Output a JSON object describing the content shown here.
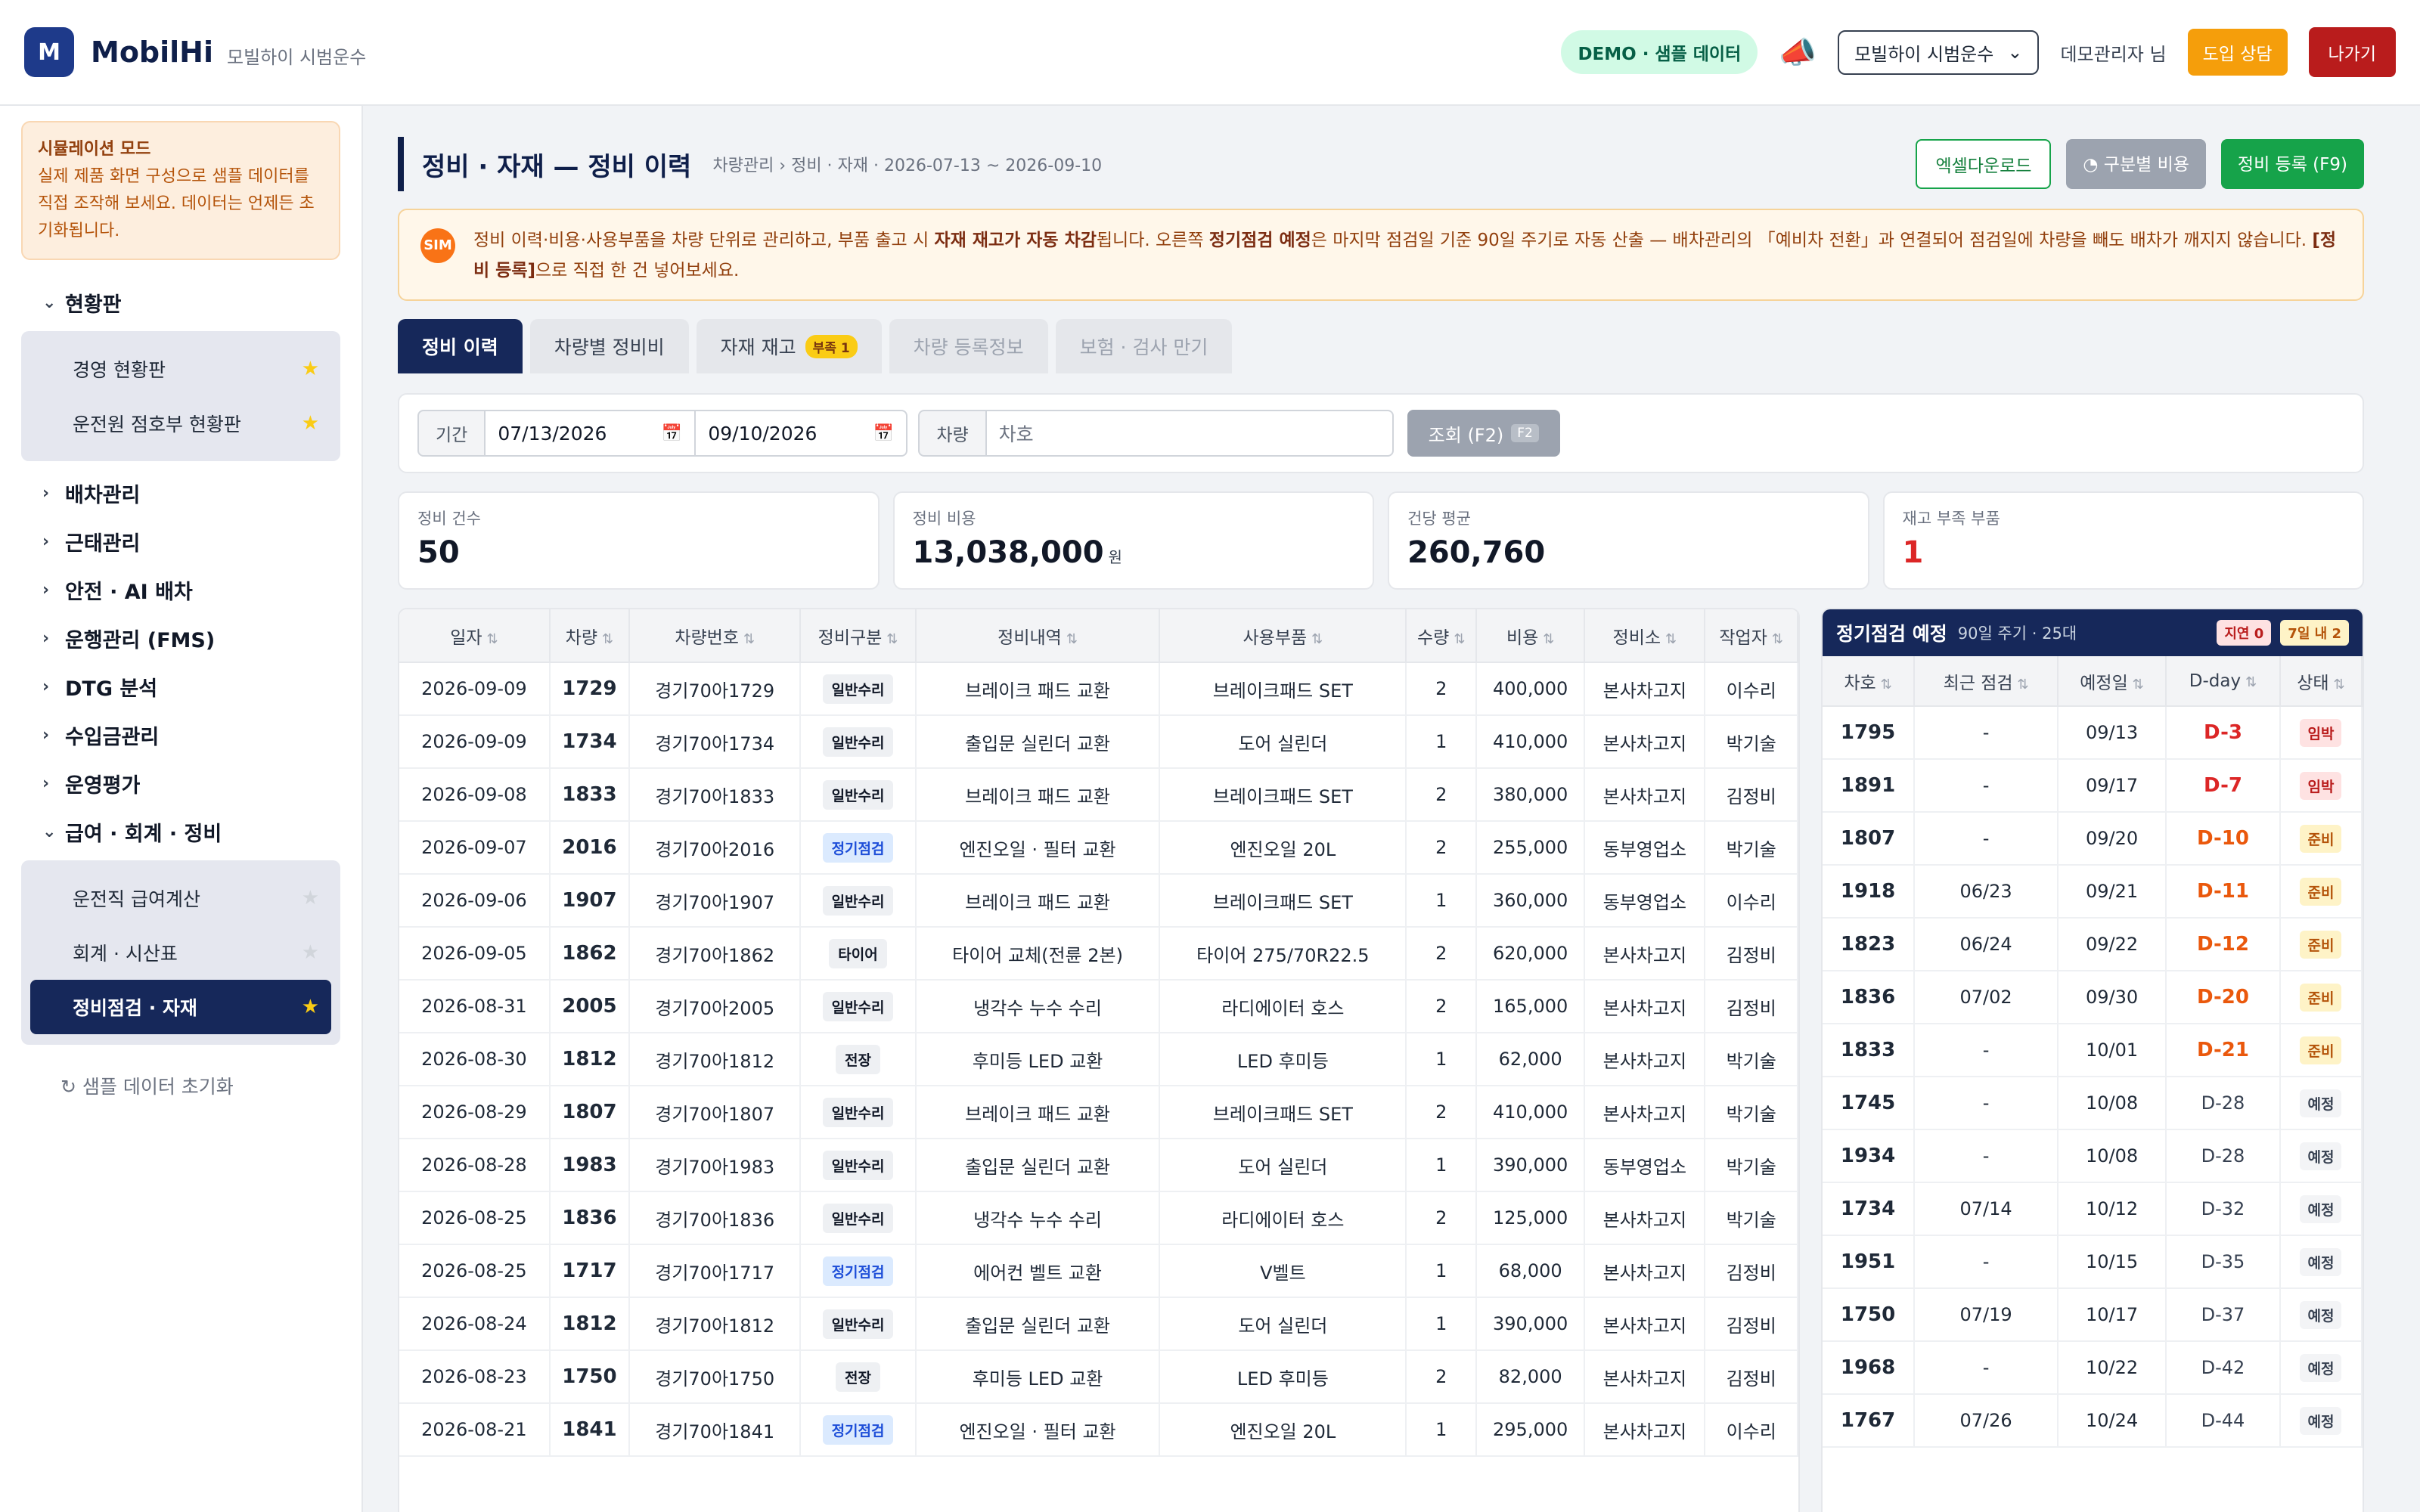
{
  "header": {
    "logo_letter": "M",
    "brand": "MobilHi",
    "brand_sub": "모빌하이 시범운수",
    "demo_pill": "DEMO · 샘플 데이터",
    "company_select": "모빌하이 시범운수",
    "user": "데모관리자 님",
    "consult_btn": "도입 상담",
    "exit_btn": "나가기"
  },
  "sidebar": {
    "sim_title": "시뮬레이션 모드",
    "sim_text": "실제 제품 화면 구성으로 샘플 데이터를 직접 조작해 보세요. 데이터는 언제든 초기화됩니다.",
    "groups": [
      {
        "label": "현황판",
        "open": true,
        "items": [
          {
            "label": "경영 현황판",
            "starred": true
          },
          {
            "label": "운전원 점호부 현황판",
            "starred": true
          }
        ]
      },
      {
        "label": "배차관리",
        "open": false
      },
      {
        "label": "근태관리",
        "open": false
      },
      {
        "label": "안전 · AI 배차",
        "open": false
      },
      {
        "label": "운행관리 (FMS)",
        "open": false
      },
      {
        "label": "DTG 분석",
        "open": false
      },
      {
        "label": "수입금관리",
        "open": false
      },
      {
        "label": "운영평가",
        "open": false
      },
      {
        "label": "급여 · 회계 · 정비",
        "open": true,
        "items": [
          {
            "label": "운전직 급여계산",
            "starred": false
          },
          {
            "label": "회계 · 시산표",
            "starred": false
          },
          {
            "label": "정비점검 · 자재",
            "starred": true,
            "active": true
          }
        ]
      }
    ],
    "reset": "샘플 데이터 초기화"
  },
  "page": {
    "title": "정비 · 자재 — 정비 이력",
    "breadcrumb": "차량관리 › 정비 · 자재 · 2026-07-13 ~ 2026-09-10",
    "excel_btn": "엑셀다운로드",
    "cost_btn": "구분별 비용",
    "register_btn": "정비 등록 (F9)"
  },
  "notice": {
    "icon": "SIM",
    "p1": "정비 이력·비용·사용부품을 차량 단위로 관리하고, 부품 출고 시 ",
    "b1": "자재 재고가 자동 차감",
    "p2": "됩니다. 오른쪽 ",
    "b2": "정기점검 예정",
    "p3": "은 마지막 점검일 기준 90일 주기로 자동 산출 — 배차관리의 「예비차 전환」과 연결되어 점검일에 차량을 빼도 배차가 깨지지 않습니다. ",
    "b3": "[정비 등록]",
    "p4": "으로 직접 한 건 넣어보세요."
  },
  "tabs": [
    {
      "label": "정비 이력",
      "state": "active"
    },
    {
      "label": "차량별 정비비",
      "state": "normal"
    },
    {
      "label": "자재 재고",
      "state": "normal",
      "badge": "부족 1"
    },
    {
      "label": "차량 등록정보",
      "state": "disabled"
    },
    {
      "label": "보험 · 검사 만기",
      "state": "disabled"
    }
  ],
  "filter": {
    "period_label": "기간",
    "date_from": "07/13/2026",
    "date_to": "09/10/2026",
    "vehicle_label": "차량",
    "vehicle_placeholder": "차호",
    "search_btn": "조회 (F2)",
    "search_kbd": "F2"
  },
  "stats": [
    {
      "label": "정비 건수",
      "value": "50",
      "unit": ""
    },
    {
      "label": "정비 비용",
      "value": "13,038,000",
      "unit": "원"
    },
    {
      "label": "건당 평균",
      "value": "260,760",
      "unit": ""
    },
    {
      "label": "재고 부족 부품",
      "value": "1",
      "unit": "",
      "red": true
    }
  ],
  "table": {
    "columns": [
      "일자",
      "차량",
      "차량번호",
      "정비구분",
      "정비내역",
      "사용부품",
      "수량",
      "비용",
      "정비소",
      "작업자"
    ],
    "rows": [
      [
        "2026-09-09",
        "1729",
        "경기70아1729",
        "일반수리",
        "브레이크 패드 교환",
        "브레이크패드 SET",
        "2",
        "400,000",
        "본사차고지",
        "이수리"
      ],
      [
        "2026-09-09",
        "1734",
        "경기70아1734",
        "일반수리",
        "출입문 실린더 교환",
        "도어 실린더",
        "1",
        "410,000",
        "본사차고지",
        "박기술"
      ],
      [
        "2026-09-08",
        "1833",
        "경기70아1833",
        "일반수리",
        "브레이크 패드 교환",
        "브레이크패드 SET",
        "2",
        "380,000",
        "본사차고지",
        "김정비"
      ],
      [
        "2026-09-07",
        "2016",
        "경기70아2016",
        "정기점검",
        "엔진오일 · 필터 교환",
        "엔진오일 20L",
        "2",
        "255,000",
        "동부영업소",
        "박기술"
      ],
      [
        "2026-09-06",
        "1907",
        "경기70아1907",
        "일반수리",
        "브레이크 패드 교환",
        "브레이크패드 SET",
        "1",
        "360,000",
        "동부영업소",
        "이수리"
      ],
      [
        "2026-09-05",
        "1862",
        "경기70아1862",
        "타이어",
        "타이어 교체(전륜 2본)",
        "타이어 275/70R22.5",
        "2",
        "620,000",
        "본사차고지",
        "김정비"
      ],
      [
        "2026-08-31",
        "2005",
        "경기70아2005",
        "일반수리",
        "냉각수 누수 수리",
        "라디에이터 호스",
        "2",
        "165,000",
        "본사차고지",
        "김정비"
      ],
      [
        "2026-08-30",
        "1812",
        "경기70아1812",
        "전장",
        "후미등 LED 교환",
        "LED 후미등",
        "1",
        "62,000",
        "본사차고지",
        "박기술"
      ],
      [
        "2026-08-29",
        "1807",
        "경기70아1807",
        "일반수리",
        "브레이크 패드 교환",
        "브레이크패드 SET",
        "2",
        "410,000",
        "본사차고지",
        "박기술"
      ],
      [
        "2026-08-28",
        "1983",
        "경기70아1983",
        "일반수리",
        "출입문 실린더 교환",
        "도어 실린더",
        "1",
        "390,000",
        "동부영업소",
        "박기술"
      ],
      [
        "2026-08-25",
        "1836",
        "경기70아1836",
        "일반수리",
        "냉각수 누수 수리",
        "라디에이터 호스",
        "2",
        "125,000",
        "본사차고지",
        "박기술"
      ],
      [
        "2026-08-25",
        "1717",
        "경기70아1717",
        "정기점검",
        "에어컨 벨트 교환",
        "V벨트",
        "1",
        "68,000",
        "본사차고지",
        "김정비"
      ],
      [
        "2026-08-24",
        "1812",
        "경기70아1812",
        "일반수리",
        "출입문 실린더 교환",
        "도어 실린더",
        "1",
        "390,000",
        "본사차고지",
        "김정비"
      ],
      [
        "2026-08-23",
        "1750",
        "경기70아1750",
        "전장",
        "후미등 LED 교환",
        "LED 후미등",
        "2",
        "82,000",
        "본사차고지",
        "김정비"
      ],
      [
        "2026-08-21",
        "1841",
        "경기70아1841",
        "정기점검",
        "엔진오일 · 필터 교환",
        "엔진오일 20L",
        "1",
        "295,000",
        "본사차고지",
        "이수리"
      ]
    ]
  },
  "panel": {
    "title": "정기점검 예정",
    "sub": "90일 주기 · 25대",
    "badge_delay": "지연 0",
    "badge_week": "7일 내 2",
    "columns": [
      "차호",
      "최근 점검",
      "예정일",
      "D-day",
      "상태"
    ],
    "rows": [
      [
        "1795",
        "-",
        "09/13",
        "D-3",
        "임박"
      ],
      [
        "1891",
        "-",
        "09/17",
        "D-7",
        "임박"
      ],
      [
        "1807",
        "-",
        "09/20",
        "D-10",
        "준비"
      ],
      [
        "1918",
        "06/23",
        "09/21",
        "D-11",
        "준비"
      ],
      [
        "1823",
        "06/24",
        "09/22",
        "D-12",
        "준비"
      ],
      [
        "1836",
        "07/02",
        "09/30",
        "D-20",
        "준비"
      ],
      [
        "1833",
        "-",
        "10/01",
        "D-21",
        "준비"
      ],
      [
        "1745",
        "-",
        "10/08",
        "D-28",
        "예정"
      ],
      [
        "1934",
        "-",
        "10/08",
        "D-28",
        "예정"
      ],
      [
        "1734",
        "07/14",
        "10/12",
        "D-32",
        "예정"
      ],
      [
        "1951",
        "-",
        "10/15",
        "D-35",
        "예정"
      ],
      [
        "1750",
        "07/19",
        "10/17",
        "D-37",
        "예정"
      ],
      [
        "1968",
        "-",
        "10/22",
        "D-42",
        "예정"
      ],
      [
        "1767",
        "07/26",
        "10/24",
        "D-44",
        "예정"
      ]
    ]
  }
}
